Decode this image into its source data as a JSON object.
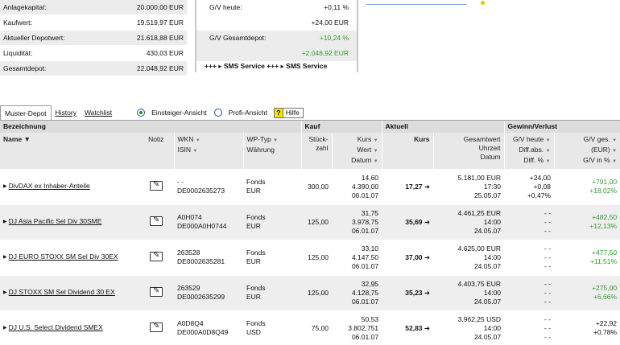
{
  "summary_left": [
    {
      "label": "Anlagekapital:",
      "value": "20.000,00 EUR"
    },
    {
      "label": "Kaufwert:",
      "value": "19.519,97 EUR"
    },
    {
      "label": "Aktueller Depotwert:",
      "value": "21.618,88 EUR"
    },
    {
      "label": "Liquidität:",
      "value": "430,03 EUR"
    },
    {
      "label": "Gesamtdepot:",
      "value": "22.048,92 EUR"
    }
  ],
  "summary_mid": {
    "gv_heute_label": "G/V heute:",
    "gv_heute_pct": "+0,11 %",
    "gv_heute_abs": "+24,00 EUR",
    "gv_gesamt_label": "G/V Gesamtdepot:",
    "gv_gesamt_pct": "+10,24 %",
    "gv_gesamt_abs": "+2.048,92 EUR",
    "sms_service": "+++ ▸ SMS Service +++ ▸ SMS Service"
  },
  "tabs": {
    "muster": "Muster-Depot",
    "history": "History",
    "watchlist": "Watchlist"
  },
  "view": {
    "einsteiger": "Einsteiger-Ansicht",
    "profi": "Profi-Ansicht",
    "hilfe_q": "?",
    "hilfe": "Hilfe"
  },
  "header_groups": {
    "bezeichnung": "Bezeichnung",
    "kauf": "Kauf",
    "aktuell": "Aktuell",
    "gewinn": "Gewinn/Verlust"
  },
  "columns": {
    "name": "Name",
    "name_arrow": "▼",
    "notiz": "Notiz",
    "wkn": "WKN",
    "isin": "ISIN",
    "wptyp": "WP-Typ",
    "waehrung": "Währung",
    "stueck": "Stück-",
    "zahl": "zahl",
    "kurs": "Kurs",
    "wert": "Wert",
    "datum": "Datum",
    "akt_kurs": "Kurs",
    "gesamtwert": "Gesamtwert",
    "uhrzeit": "Uhrzeit",
    "akt_datum": "Datum",
    "gv_heute": "G/V heute",
    "diff_abs": "Diff.abs.",
    "diff_pct": "Diff. %",
    "gv_ges": "G/V ges.",
    "eur": "(EUR)",
    "gv_in_pct": "G/V in %",
    "sort_tri": "▼"
  },
  "rows": [
    {
      "name": "DivDAX ex Inhaber-Anteile",
      "wkn": "- -",
      "isin": "DE0002635273",
      "typ": "Fonds",
      "waehrung": "EUR",
      "stueck": "300,00",
      "kauf_kurs": "14,60",
      "kauf_wert": "4.390,00",
      "kauf_datum": "06.01.07",
      "akt_kurs": "17,27",
      "arrow": "➜",
      "gesamtwert": "5.181,00 EUR",
      "uhrzeit": "17:30",
      "akt_datum": "25.05.07",
      "gvh1": "+24,00",
      "gvh2": "+0,08",
      "gvh3": "+0,47%",
      "gvg1": "+791,00",
      "gvg2": "+18,02%"
    },
    {
      "name": "DJ Asia Pacific Sel Div 30SME",
      "wkn": "A0H074",
      "isin": "DE000A0H0744",
      "typ": "Fonds",
      "waehrung": "EUR",
      "stueck": "125,00",
      "kauf_kurs": "31,75",
      "kauf_wert": "3.978,75",
      "kauf_datum": "06.01.07",
      "akt_kurs": "35,69",
      "arrow": "➜",
      "gesamtwert": "4.461,25 EUR",
      "uhrzeit": "14:00",
      "akt_datum": "24.05.07",
      "gvh1": "- -",
      "gvh2": "- -",
      "gvh3": "- -",
      "gvg1": "+482,50",
      "gvg2": "+12,13%"
    },
    {
      "name": "DJ EURO STOXX SM Sel Div 30EX",
      "wkn": "263528",
      "isin": "DE0002635281",
      "typ": "Fonds",
      "waehrung": "EUR",
      "stueck": "125,00",
      "kauf_kurs": "33,10",
      "kauf_wert": "4.147,50",
      "kauf_datum": "06.01.07",
      "akt_kurs": "37,00",
      "arrow": "➜",
      "gesamtwert": "4.625,00 EUR",
      "uhrzeit": "14:00",
      "akt_datum": "24.05.07",
      "gvh1": "- -",
      "gvh2": "- -",
      "gvh3": "- -",
      "gvg1": "+477,50",
      "gvg2": "+11,51%"
    },
    {
      "name": "DJ STOXX SM Sel Dividend 30 EX",
      "wkn": "263529",
      "isin": "DE0002635299",
      "typ": "Fonds",
      "waehrung": "EUR",
      "stueck": "125,00",
      "kauf_kurs": "32,95",
      "kauf_wert": "4.128,75",
      "kauf_datum": "06.01.07",
      "akt_kurs": "35,23",
      "arrow": "➜",
      "gesamtwert": "4.403,75 EUR",
      "uhrzeit": "14:00",
      "akt_datum": "24.05.07",
      "gvh1": "- -",
      "gvh2": "- -",
      "gvh3": "- -",
      "gvg1": "+275,00",
      "gvg2": "+6,66%"
    },
    {
      "name": "DJ U.S. Select Dividend SMEX",
      "wkn": "A0D8Q4",
      "isin": "DE000A0D8Q49",
      "typ": "Fonds",
      "waehrung": "USD",
      "stueck": "75,00",
      "kauf_kurs": "50,53",
      "kauf_wert": "3.802,751",
      "kauf_datum": "06.01.07",
      "akt_kurs": "52,83",
      "arrow": "➜",
      "gesamtwert": "3.962,25 USD",
      "uhrzeit": "14:00",
      "akt_datum": "24.05.07",
      "gvh1": "- -",
      "gvh2": "- -",
      "gvh3": "- -",
      "gvg1": "+22,92",
      "gvg2": "+0,78%"
    }
  ],
  "colors": {
    "positive": "#2f9b2f",
    "header_bg": "#dcdcdc",
    "row_alt": "#eeeeee",
    "hilfe_yellow": "#f2e600"
  }
}
